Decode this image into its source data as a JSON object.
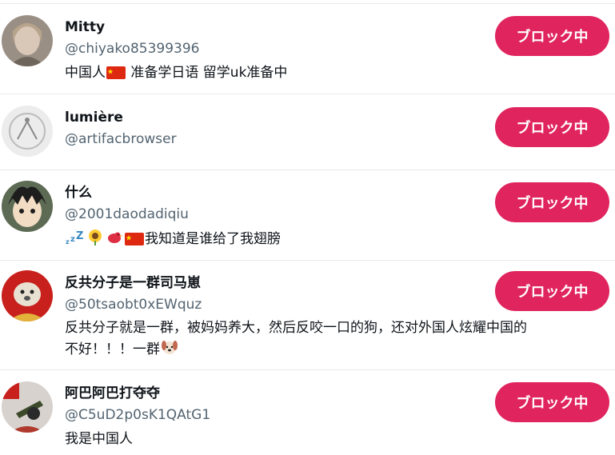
{
  "block_button_label": "ブロック中",
  "accent_color": "#e0245e",
  "users": [
    {
      "name": "Mitty",
      "handle": "@chiyako85399396",
      "bio_parts": [
        "中国人",
        "准备学日语 留学uk准备中"
      ],
      "bio_icons": [
        "china-flag-emoji"
      ]
    },
    {
      "name": "lumière",
      "handle": "@artifacbrowser",
      "bio_parts": [],
      "bio_icons": []
    },
    {
      "name": "什么",
      "handle": "@2001daodadiqiu",
      "bio_parts": [
        "我知道是谁给了我翅膀"
      ],
      "bio_icons": [
        "zzz-emoji",
        "sunflower-emoji",
        "bird-emoji",
        "china-flag-emoji"
      ]
    },
    {
      "name": "反共分子是一群司马崽",
      "handle": "@50tsaobt0xEWquz",
      "bio_parts": [
        "反共分子就是一群，被妈妈养大，然后反咬一口的狗，还对外国人炫耀中国的",
        "不好！！！一群"
      ],
      "bio_icons": [
        "dog-face-emoji"
      ]
    },
    {
      "name": "阿巴阿巴打夺夺",
      "handle": "@C5uD2p0sK1QAtG1",
      "bio_parts": [
        "我是中国人"
      ],
      "bio_icons": []
    }
  ]
}
